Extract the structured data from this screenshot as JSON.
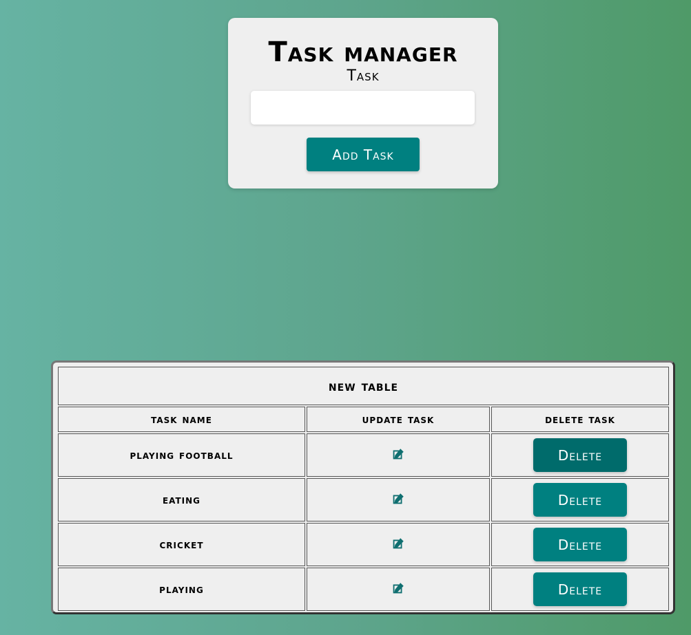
{
  "form": {
    "title": "Task manager",
    "task_label": "Task",
    "task_input_value": "",
    "task_input_placeholder": "",
    "add_button_label": "Add Task"
  },
  "table": {
    "title": "new table",
    "headers": [
      "task name",
      "update task",
      "delete task"
    ],
    "rows": [
      {
        "name": "playing football",
        "delete_label": "Delete",
        "edit_icon": "edit-icon"
      },
      {
        "name": "eating",
        "delete_label": "Delete",
        "edit_icon": "edit-icon"
      },
      {
        "name": "cricket",
        "delete_label": "Delete",
        "edit_icon": "edit-icon"
      },
      {
        "name": "playing",
        "delete_label": "Delete",
        "edit_icon": "edit-icon"
      }
    ]
  },
  "colors": {
    "accent": "#008080",
    "accent_hover": "#006b6b",
    "card_bg": "#efefef"
  }
}
